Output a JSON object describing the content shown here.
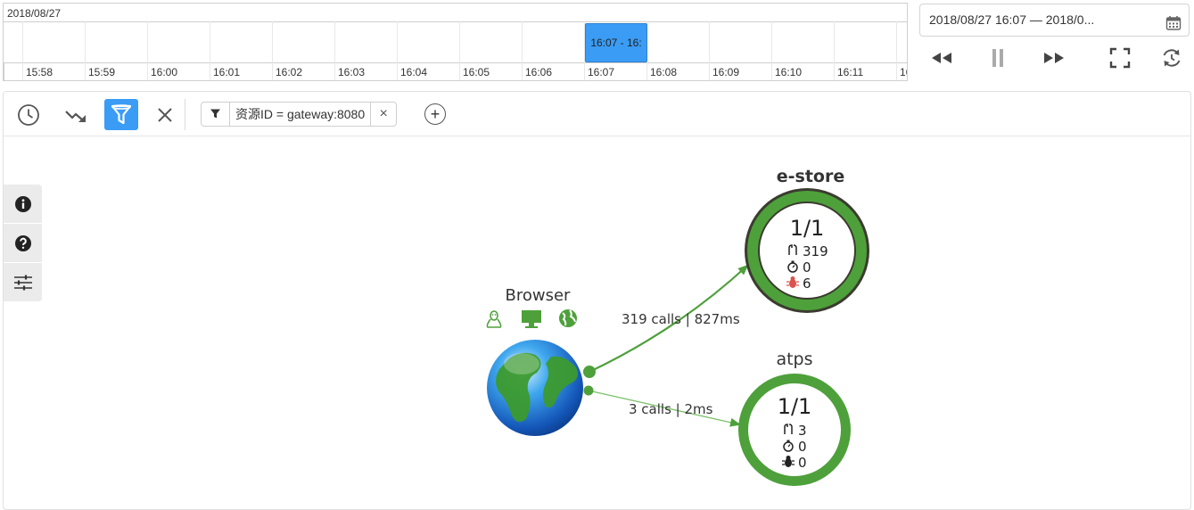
{
  "timeline": {
    "date": "2018/08/27",
    "ticks": [
      "15:58",
      "15:59",
      "16:00",
      "16:01",
      "16:02",
      "16:03",
      "16:04",
      "16:05",
      "16:06",
      "16:07",
      "16:08",
      "16:09",
      "16:10",
      "16:11",
      "16"
    ],
    "selection_label": "16:07 - 16:"
  },
  "date_range": {
    "text": "2018/08/27 16:07 — 2018/0...",
    "icon": "calendar-icon"
  },
  "playback": {
    "rewind_icon": "rewind-icon",
    "pause_icon": "pause-icon",
    "forward_icon": "fast-forward-icon",
    "fullscreen_icon": "fullscreen-icon",
    "refresh_icon": "auto-refresh-icon"
  },
  "toolbar": {
    "buttons": [
      "clock-icon",
      "trend-down-icon",
      "filter-icon",
      "close-icon"
    ],
    "filter_text": "资源ID = gateway:8080",
    "filter_remove": "×",
    "add_label": "+"
  },
  "side_tools": [
    "info-icon",
    "help-icon",
    "sliders-icon"
  ],
  "graph": {
    "browser": {
      "label": "Browser",
      "icons": [
        "linux-icon",
        "desktop-icon",
        "globe-icon"
      ]
    },
    "nodes": [
      {
        "name": "e-store",
        "ratio": "1/1",
        "calls": "319",
        "time": "0",
        "errors": "6",
        "ring_color": "#4ea03b",
        "error_color": "#d9534f"
      },
      {
        "name": "atps",
        "ratio": "1/1",
        "calls": "3",
        "time": "0",
        "errors": "0",
        "ring_color": "#4ea03b",
        "error_color": "#333333"
      }
    ],
    "edges": [
      {
        "label": "319 calls | 827ms"
      },
      {
        "label": "3 calls | 2ms"
      }
    ],
    "colors": {
      "edge": "#4ea03b",
      "accent": "#3a9cf5"
    }
  }
}
